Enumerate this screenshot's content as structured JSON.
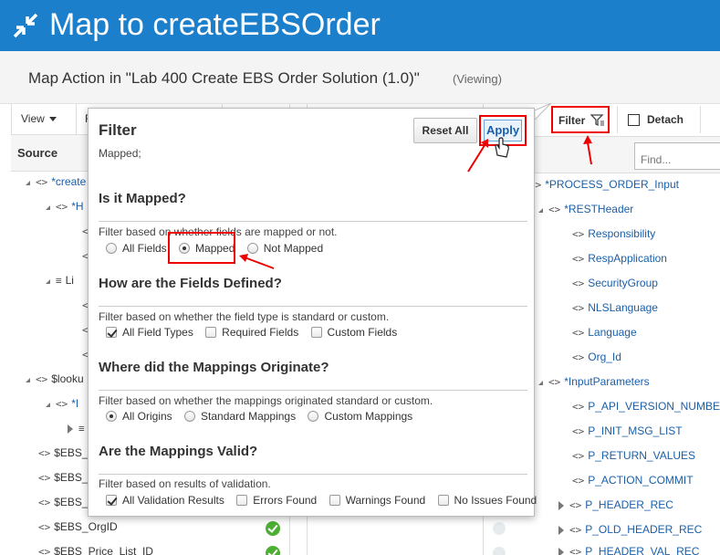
{
  "header": {
    "title": "Map to createEBSOrder",
    "icon": "collapse-arrows-icon"
  },
  "subheader": {
    "title": "Map Action in \"Lab 400 Create EBS Order Solution (1.0)\"",
    "status": "(Viewing)"
  },
  "left_panel": {
    "toolbar": {
      "view_label": "View",
      "f_label": "F"
    },
    "source_header": "Source",
    "rows": [
      {
        "label": "*create",
        "icon": "<>"
      },
      {
        "label": "*H",
        "icon": "<>"
      },
      {
        "label": "Li",
        "icon": "list-icon"
      },
      {
        "label": "$looku",
        "icon": "<>"
      },
      {
        "label": "*I",
        "icon": "<>"
      },
      {
        "label": "$EBS_",
        "icon": "<>"
      },
      {
        "label": "$EBS_",
        "icon": "<>"
      },
      {
        "label": "$EBS_",
        "icon": "<>"
      },
      {
        "label": "$EBS_OrgID",
        "icon": "<>"
      },
      {
        "label": "$EBS_Price_List_ID",
        "icon": "<>"
      }
    ]
  },
  "right_panel": {
    "filter_label": "Filter",
    "detach_label": "Detach",
    "find_placeholder": "Find...",
    "rows": [
      {
        "label": "*PROCESS_ORDER_Input"
      },
      {
        "label": "*RESTHeader"
      },
      {
        "label": "Responsibility"
      },
      {
        "label": "RespApplication"
      },
      {
        "label": "SecurityGroup"
      },
      {
        "label": "NLSLanguage"
      },
      {
        "label": "Language"
      },
      {
        "label": "Org_Id"
      },
      {
        "label": "*InputParameters"
      },
      {
        "label": "P_API_VERSION_NUMBE"
      },
      {
        "label": "P_INIT_MSG_LIST"
      },
      {
        "label": "P_RETURN_VALUES"
      },
      {
        "label": "P_ACTION_COMMIT"
      },
      {
        "label": "P_HEADER_REC"
      },
      {
        "label": "P_OLD_HEADER_REC"
      },
      {
        "label": "P_HEADER_VAL_REC"
      }
    ]
  },
  "filter_popup": {
    "title": "Filter",
    "summary": "Mapped;",
    "reset_label": "Reset All",
    "apply_label": "Apply",
    "sections": [
      {
        "heading": "Is it Mapped?",
        "description": "Filter based on whether fields are mapped or not.",
        "options": [
          "All Fields",
          "Mapped",
          "Not Mapped"
        ]
      },
      {
        "heading": "How are the Fields Defined?",
        "description": "Filter based on whether the field type is standard or custom.",
        "options": [
          "All Field Types",
          "Required Fields",
          "Custom Fields"
        ]
      },
      {
        "heading": "Where did the Mappings Originate?",
        "description": "Filter based on whether the mappings originated standard or custom.",
        "options": [
          "All Origins",
          "Standard Mappings",
          "Custom Mappings"
        ]
      },
      {
        "heading": "Are the Mappings Valid?",
        "description": "Filter based on results of validation.",
        "options": [
          "All Validation Results",
          "Errors Found",
          "Warnings Found",
          "No Issues Found"
        ]
      }
    ]
  },
  "colors": {
    "header_bg": "#1b7fcc",
    "highlight": "#ee0000",
    "link": "#1a5fa8",
    "mapped_check": "#4caf33"
  }
}
